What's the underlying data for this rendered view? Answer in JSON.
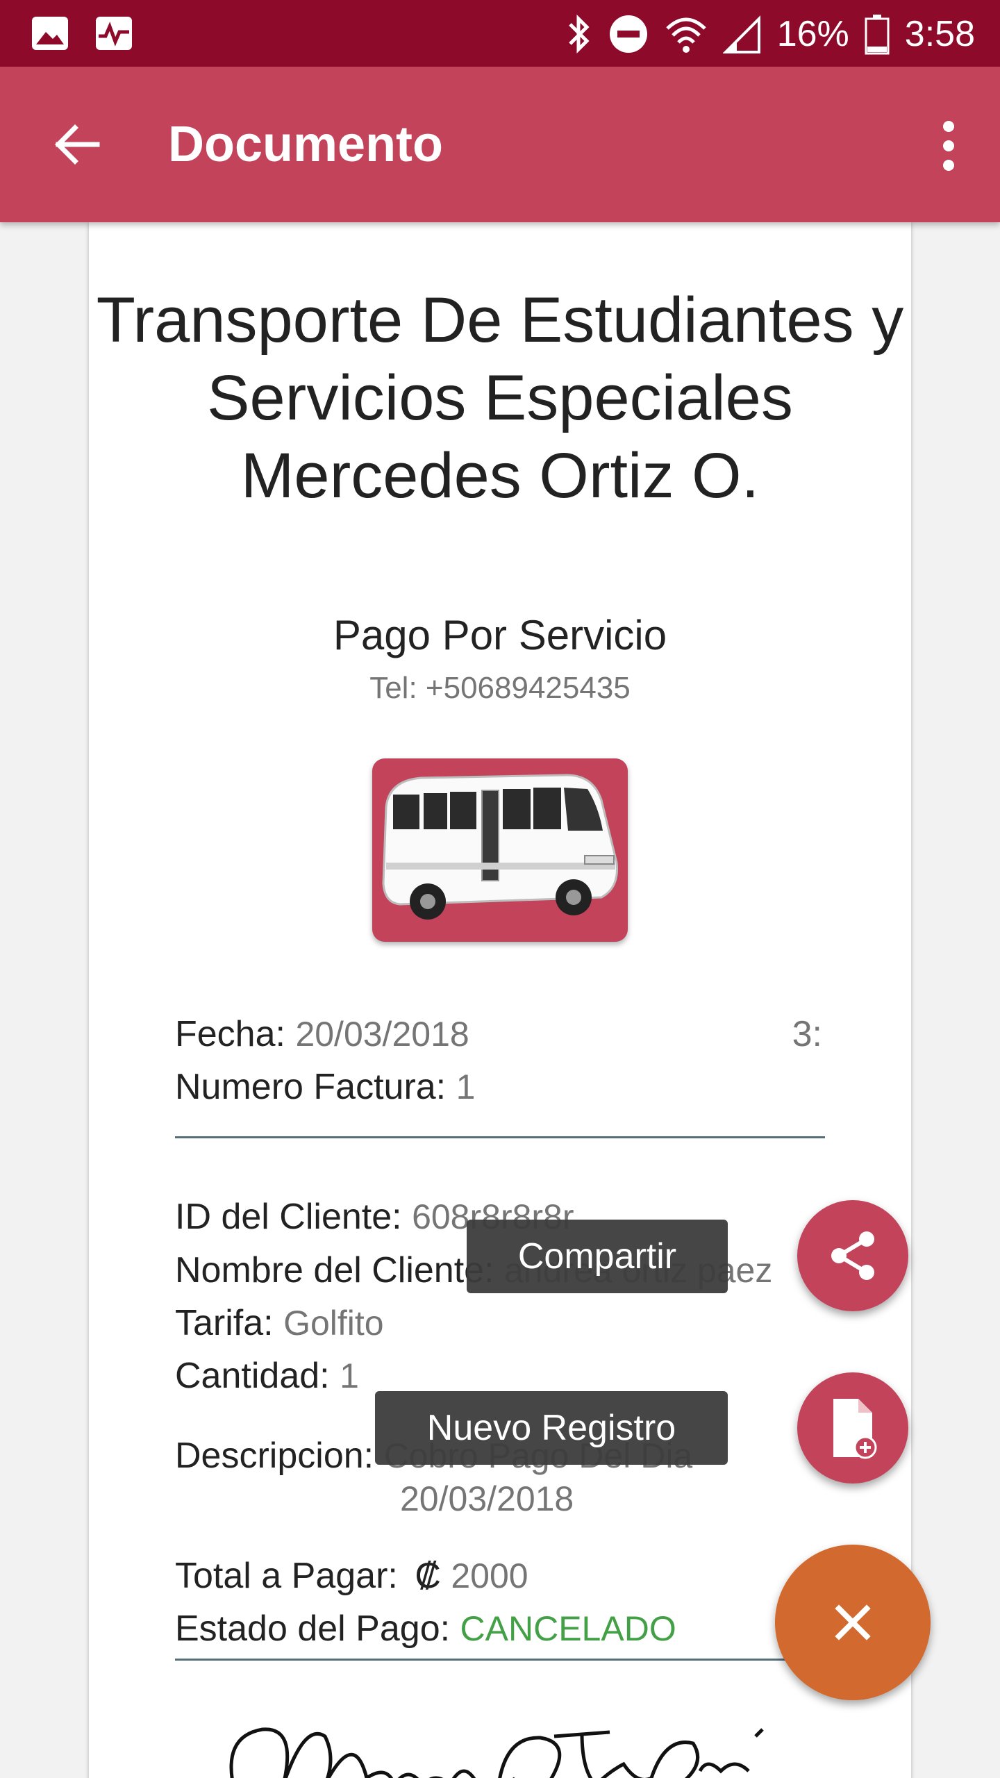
{
  "status_bar": {
    "battery": "16%",
    "time": "3:58",
    "icons": [
      "gallery-icon",
      "activity-icon",
      "bluetooth-icon",
      "do-not-disturb-icon",
      "wifi-icon",
      "signal-icon",
      "battery-icon"
    ]
  },
  "app_bar": {
    "title": "Documento",
    "back_icon": "arrow-left-icon",
    "menu_icon": "more-vert-icon"
  },
  "document": {
    "company": "Transporte De Estudiantes y Servicios Especiales Mercedes Ortiz O.",
    "subtitle": "Pago Por Servicio",
    "tel": "Tel: +50689425435",
    "fecha_label": "Fecha:",
    "fecha_value": "20/03/2018",
    "hora_value": "3:",
    "factura_label": "Numero Factura:",
    "factura_value": "1",
    "cliente_id_label": "ID del Cliente:",
    "cliente_id_value": "608r8r8r8r",
    "cliente_nombre_label": "Nombre del Cliente:",
    "cliente_nombre_value": "andrea ortiz paez",
    "tarifa_label": "Tarifa:",
    "tarifa_value": "Golfito",
    "cantidad_label": "Cantidad:",
    "cantidad_value": "1",
    "descripcion_label": "Descripcion:",
    "descripcion_line1": "Cobro Pago Del Dia",
    "descripcion_line2": "20/03/2018",
    "total_label": "Total a Pagar:",
    "currency": "₡",
    "total_value": "2000",
    "estado_label": "Estado del Pago:",
    "estado_value": "CANCELADO",
    "signature_text": "Mercedes Ortiz Olmos."
  },
  "fab": {
    "share_tooltip": "Compartir",
    "new_tooltip": "Nuevo Registro",
    "share_icon": "share-icon",
    "new_icon": "new-document-icon",
    "close_icon": "close-icon"
  }
}
